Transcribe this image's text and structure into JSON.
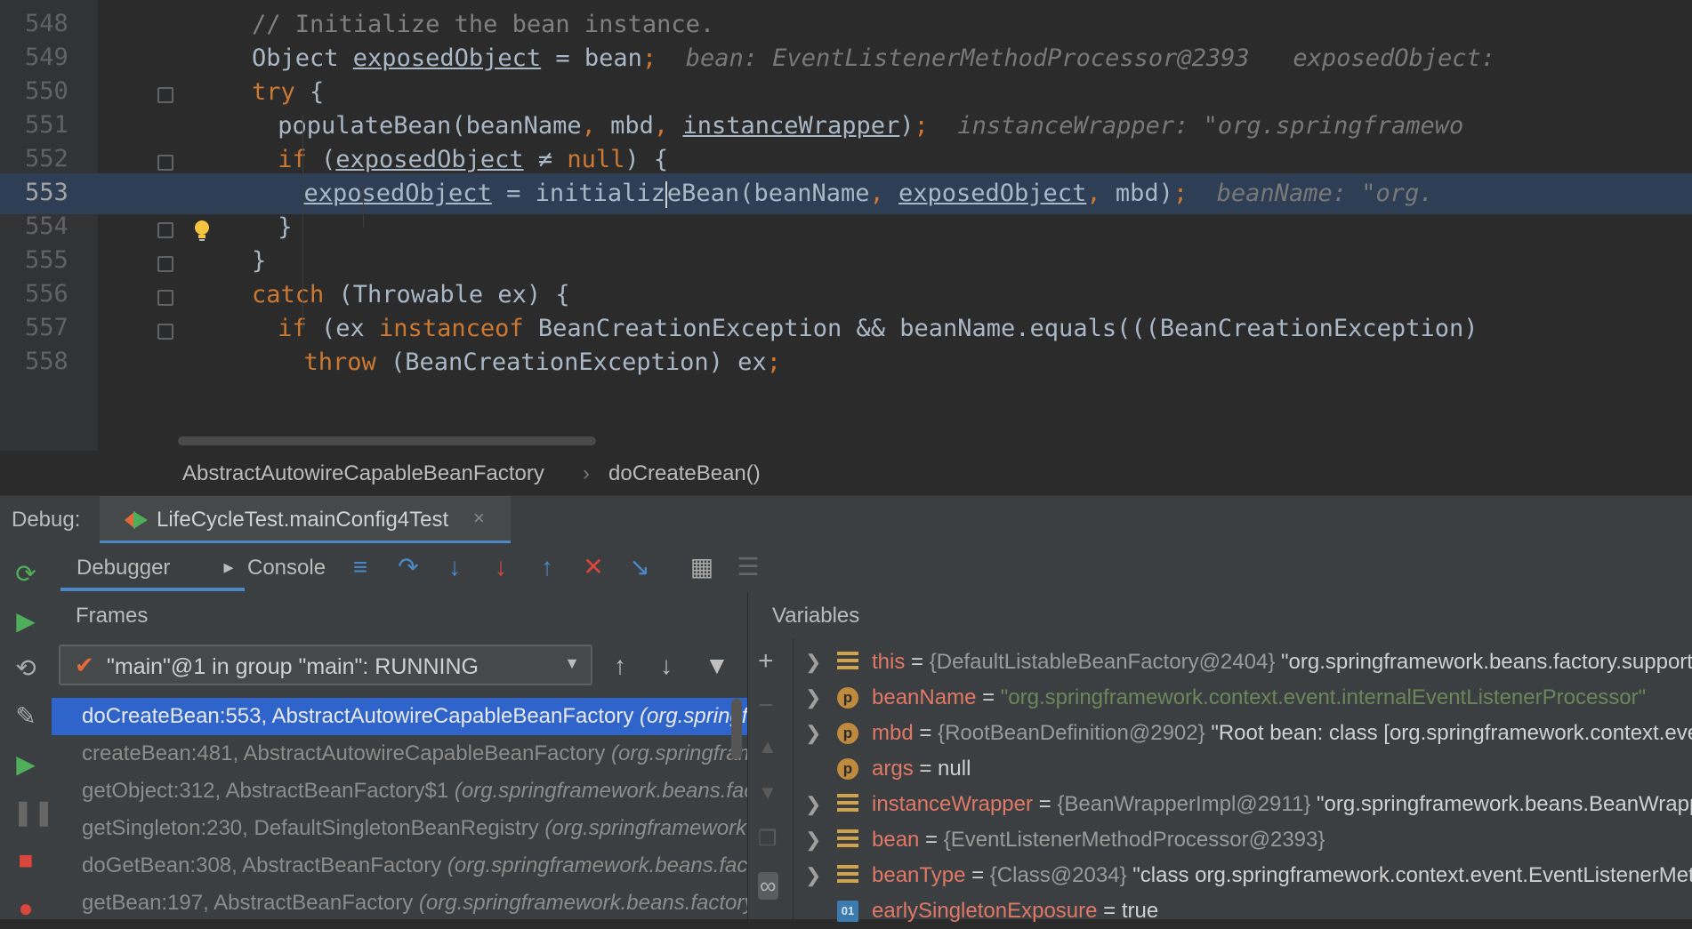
{
  "editor": {
    "lines": [
      {
        "num": "548",
        "indent": 4,
        "segments": [
          {
            "t": "// Initialize the bean instance.",
            "c": "cm"
          }
        ]
      },
      {
        "num": "549",
        "indent": 4,
        "segments": [
          {
            "t": "Object ",
            "c": "fn"
          },
          {
            "t": "exposedObject",
            "c": "fn ul"
          },
          {
            "t": " = bean",
            "c": "fn"
          },
          {
            "t": ";",
            "c": "kw"
          },
          {
            "t": "  bean: EventListenerMethodProcessor@2393   exposedObject:",
            "c": "hint"
          }
        ]
      },
      {
        "num": "550",
        "indent": 4,
        "segments": [
          {
            "t": "try",
            "c": "kw"
          },
          {
            "t": " {",
            "c": "fn"
          }
        ]
      },
      {
        "num": "551",
        "indent": 6,
        "segments": [
          {
            "t": "populateBean(beanName",
            "c": "fn"
          },
          {
            "t": ", ",
            "c": "kw"
          },
          {
            "t": "mbd",
            "c": "fn"
          },
          {
            "t": ", ",
            "c": "kw"
          },
          {
            "t": "instanceWrapper",
            "c": "fn ul"
          },
          {
            "t": ")",
            "c": "fn"
          },
          {
            "t": ";",
            "c": "kw"
          },
          {
            "t": "  instanceWrapper: \"org.springframewo",
            "c": "hint"
          }
        ]
      },
      {
        "num": "552",
        "indent": 6,
        "segments": [
          {
            "t": "if",
            "c": "kw"
          },
          {
            "t": " (",
            "c": "fn"
          },
          {
            "t": "exposedObject",
            "c": "fn ul"
          },
          {
            "t": " ≠ ",
            "c": "fn"
          },
          {
            "t": "null",
            "c": "kw"
          },
          {
            "t": ") {",
            "c": "fn"
          }
        ]
      },
      {
        "num": "553",
        "indent": 8,
        "highlight": true,
        "segments": [
          {
            "t": "exposedObject",
            "c": "fn ul"
          },
          {
            "t": " = initializ",
            "c": "fn"
          },
          {
            "t": "|",
            "c": "caret"
          },
          {
            "t": "eBean(beanName",
            "c": "fn"
          },
          {
            "t": ", ",
            "c": "kw"
          },
          {
            "t": "exposedObject",
            "c": "fn ul"
          },
          {
            "t": ", ",
            "c": "kw"
          },
          {
            "t": "mbd)",
            "c": "fn"
          },
          {
            "t": ";",
            "c": "kw"
          },
          {
            "t": "  beanName: \"org.",
            "c": "hint"
          }
        ]
      },
      {
        "num": "554",
        "indent": 6,
        "segments": [
          {
            "t": "}",
            "c": "fn"
          }
        ]
      },
      {
        "num": "555",
        "indent": 4,
        "segments": [
          {
            "t": "}",
            "c": "fn"
          }
        ]
      },
      {
        "num": "556",
        "indent": 4,
        "segments": [
          {
            "t": "catch",
            "c": "kw"
          },
          {
            "t": " (Throwable ex) {",
            "c": "fn"
          }
        ]
      },
      {
        "num": "557",
        "indent": 6,
        "segments": [
          {
            "t": "if",
            "c": "kw"
          },
          {
            "t": " (ex ",
            "c": "fn"
          },
          {
            "t": "instanceof",
            "c": "kw"
          },
          {
            "t": " BeanCreationException && beanName.equals(((BeanCreationException)",
            "c": "fn"
          }
        ]
      },
      {
        "num": "558",
        "indent": 8,
        "segments": [
          {
            "t": "throw",
            "c": "kw"
          },
          {
            "t": " (BeanCreationException) ex",
            "c": "fn"
          },
          {
            "t": ";",
            "c": "kw"
          }
        ]
      }
    ]
  },
  "breadcrumb": {
    "class_name": "AbstractAutowireCapableBeanFactory",
    "separator": "›",
    "method": "doCreateBean()"
  },
  "debug": {
    "label": "Debug:",
    "run_tab": "LifeCycleTest.mainConfig4Test",
    "close": "×",
    "tabs": {
      "debugger": "Debugger",
      "console": "Console"
    },
    "frames_title": "Frames",
    "variables_title": "Variables",
    "thread": "\"main\"@1 in group \"main\": RUNNING",
    "frames": [
      {
        "method": "doCreateBean:553, AbstractAutowireCapableBeanFactory ",
        "pkg": "(org.springframework.beans.factory.support)",
        "selected": true
      },
      {
        "method": "createBean:481, AbstractAutowireCapableBeanFactory ",
        "pkg": "(org.springframework.beans.factory.support)"
      },
      {
        "method": "getObject:312, AbstractBeanFactory$1 ",
        "pkg": "(org.springframework.beans.factory.support)"
      },
      {
        "method": "getSingleton:230, DefaultSingletonBeanRegistry ",
        "pkg": "(org.springframework.beans.factory.support)"
      },
      {
        "method": "doGetBean:308, AbstractBeanFactory ",
        "pkg": "(org.springframework.beans.factory.support)"
      },
      {
        "method": "getBean:197, AbstractBeanFactory ",
        "pkg": "(org.springframework.beans.factory.support)"
      }
    ],
    "variables": [
      {
        "expand": true,
        "icon": "field",
        "name": "this",
        "ref": "{DefaultListableBeanFactory@2404}",
        "value": "\"org.springframework.beans.factory.support.DefaultListableBeanFactory",
        "value_type": "plain"
      },
      {
        "expand": true,
        "icon": "param",
        "name": "beanName",
        "ref": "",
        "value": "\"org.springframework.context.event.internalEventListenerProcessor\"",
        "value_type": "string"
      },
      {
        "expand": true,
        "icon": "param",
        "name": "mbd",
        "ref": "{RootBeanDefinition@2902}",
        "value": "\"Root bean: class [org.springframework.context.event",
        "value_type": "plain"
      },
      {
        "expand": false,
        "icon": "param",
        "name": "args",
        "ref": "",
        "value": "null",
        "value_type": "plain"
      },
      {
        "expand": true,
        "icon": "field",
        "name": "instanceWrapper",
        "ref": "{BeanWrapperImpl@2911}",
        "value": "\"org.springframework.beans.BeanWrapperImpl",
        "value_type": "plain"
      },
      {
        "expand": true,
        "icon": "field",
        "name": "bean",
        "ref": "{EventListenerMethodProcessor@2393}",
        "value": "",
        "value_type": "plain"
      },
      {
        "expand": true,
        "icon": "field",
        "name": "beanType",
        "ref": "{Class@2034}",
        "value": "\"class org.springframework.context.event.EventListenerMethodProcessor",
        "value_type": "plain"
      },
      {
        "expand": false,
        "icon": "bool",
        "name": "earlySingletonExposure",
        "ref": "",
        "value": "true",
        "value_type": "plain"
      }
    ]
  },
  "colors": {
    "accent": "#4a88c7",
    "selection": "#2f65ca",
    "keyword": "#cc7832",
    "string": "#6a8759"
  }
}
